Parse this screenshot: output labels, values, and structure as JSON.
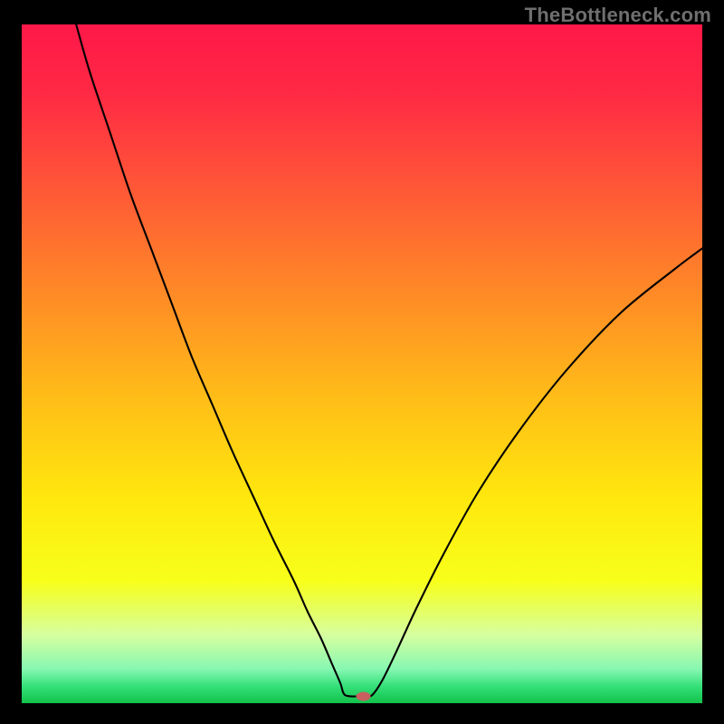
{
  "watermark": "TheBottleneck.com",
  "chart_data": {
    "type": "line",
    "title": "",
    "xlabel": "",
    "ylabel": "",
    "xlim": [
      0,
      100
    ],
    "ylim": [
      0,
      100
    ],
    "grid": false,
    "background_gradient": {
      "stops": [
        {
          "offset": 0.0,
          "color": "#ff1848"
        },
        {
          "offset": 0.1,
          "color": "#ff2944"
        },
        {
          "offset": 0.25,
          "color": "#ff5a36"
        },
        {
          "offset": 0.4,
          "color": "#ff8b26"
        },
        {
          "offset": 0.55,
          "color": "#ffbd18"
        },
        {
          "offset": 0.7,
          "color": "#ffe80d"
        },
        {
          "offset": 0.82,
          "color": "#f7ff1a"
        },
        {
          "offset": 0.9,
          "color": "#d6ffa0"
        },
        {
          "offset": 0.95,
          "color": "#86f7b1"
        },
        {
          "offset": 0.975,
          "color": "#35e07a"
        },
        {
          "offset": 1.0,
          "color": "#11c24a"
        }
      ]
    },
    "series": [
      {
        "name": "bottleneck-curve",
        "stroke": "#000000",
        "stroke_width": 2.1,
        "x": [
          8.0,
          10.0,
          13.0,
          16.0,
          19.0,
          22.0,
          25.0,
          28.0,
          31.0,
          34.0,
          37.0,
          40.0,
          42.0,
          44.0,
          45.5,
          46.8,
          47.5,
          49.5,
          50.8,
          51.6,
          53.0,
          55.0,
          58.0,
          62.0,
          67.0,
          73.0,
          80.0,
          88.0,
          96.0,
          100.0
        ],
        "y": [
          100.0,
          93.0,
          84.0,
          75.0,
          67.0,
          59.0,
          51.0,
          44.0,
          37.0,
          30.5,
          24.0,
          18.0,
          13.5,
          9.5,
          6.0,
          3.0,
          1.2,
          1.0,
          1.0,
          1.3,
          3.4,
          7.5,
          14.0,
          22.0,
          31.0,
          40.0,
          49.0,
          57.5,
          64.0,
          67.0
        ]
      }
    ],
    "markers": [
      {
        "name": "current-point",
        "x": 50.2,
        "y": 1.0,
        "fill": "#c86060",
        "rx": 8,
        "ry": 5
      }
    ]
  }
}
